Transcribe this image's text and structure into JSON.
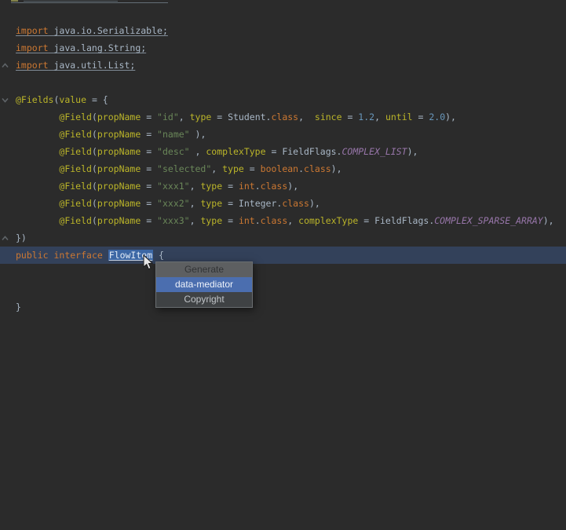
{
  "editor": {
    "language": "java",
    "lines": [
      {
        "segs": []
      },
      {
        "u": true,
        "segs": [
          [
            "kw",
            "import"
          ],
          [
            "plain",
            " java.io.Serializable;"
          ]
        ]
      },
      {
        "u": true,
        "segs": [
          [
            "kw",
            "import"
          ],
          [
            "plain",
            " java.lang.String;"
          ]
        ]
      },
      {
        "u": true,
        "segs": [
          [
            "kw",
            "import"
          ],
          [
            "plain",
            " java.util.List;"
          ]
        ]
      },
      {
        "segs": []
      },
      {
        "segs": [
          [
            "ann",
            "@Fields"
          ],
          [
            "plain",
            "("
          ],
          [
            "ann",
            "value"
          ],
          [
            "plain",
            " = {"
          ]
        ]
      },
      {
        "segs": [
          [
            "plain",
            "        "
          ],
          [
            "ann",
            "@Field"
          ],
          [
            "plain",
            "("
          ],
          [
            "ann",
            "propName"
          ],
          [
            "plain",
            " = "
          ],
          [
            "str",
            "\"id\""
          ],
          [
            "plain",
            ", "
          ],
          [
            "ann",
            "type"
          ],
          [
            "plain",
            " = Student."
          ],
          [
            "kw",
            "class"
          ],
          [
            "plain",
            ",  "
          ],
          [
            "ann",
            "since"
          ],
          [
            "plain",
            " = "
          ],
          [
            "num",
            "1.2"
          ],
          [
            "plain",
            ", "
          ],
          [
            "ann",
            "until"
          ],
          [
            "plain",
            " = "
          ],
          [
            "num",
            "2.0"
          ],
          [
            "plain",
            "),"
          ]
        ]
      },
      {
        "segs": [
          [
            "plain",
            "        "
          ],
          [
            "ann",
            "@Field"
          ],
          [
            "plain",
            "("
          ],
          [
            "ann",
            "propName"
          ],
          [
            "plain",
            " = "
          ],
          [
            "str",
            "\"name\""
          ],
          [
            "plain",
            " ),"
          ]
        ]
      },
      {
        "segs": [
          [
            "plain",
            "        "
          ],
          [
            "ann",
            "@Field"
          ],
          [
            "plain",
            "("
          ],
          [
            "ann",
            "propName"
          ],
          [
            "plain",
            " = "
          ],
          [
            "str",
            "\"desc\""
          ],
          [
            "plain",
            " , "
          ],
          [
            "ann",
            "complexType"
          ],
          [
            "plain",
            " = FieldFlags."
          ],
          [
            "const",
            "COMPLEX_LIST"
          ],
          [
            "plain",
            "),"
          ]
        ]
      },
      {
        "segs": [
          [
            "plain",
            "        "
          ],
          [
            "ann",
            "@Field"
          ],
          [
            "plain",
            "("
          ],
          [
            "ann",
            "propName"
          ],
          [
            "plain",
            " = "
          ],
          [
            "str",
            "\"selected\""
          ],
          [
            "plain",
            ", "
          ],
          [
            "ann",
            "type"
          ],
          [
            "plain",
            " = "
          ],
          [
            "kw",
            "boolean"
          ],
          [
            "plain",
            "."
          ],
          [
            "kw",
            "class"
          ],
          [
            "plain",
            "),"
          ]
        ]
      },
      {
        "segs": [
          [
            "plain",
            "        "
          ],
          [
            "ann",
            "@Field"
          ],
          [
            "plain",
            "("
          ],
          [
            "ann",
            "propName"
          ],
          [
            "plain",
            " = "
          ],
          [
            "str",
            "\"xxx1\""
          ],
          [
            "plain",
            ", "
          ],
          [
            "ann",
            "type"
          ],
          [
            "plain",
            " = "
          ],
          [
            "kw",
            "int"
          ],
          [
            "plain",
            "."
          ],
          [
            "kw",
            "class"
          ],
          [
            "plain",
            "),"
          ]
        ]
      },
      {
        "segs": [
          [
            "plain",
            "        "
          ],
          [
            "ann",
            "@Field"
          ],
          [
            "plain",
            "("
          ],
          [
            "ann",
            "propName"
          ],
          [
            "plain",
            " = "
          ],
          [
            "str",
            "\"xxx2\""
          ],
          [
            "plain",
            ", "
          ],
          [
            "ann",
            "type"
          ],
          [
            "plain",
            " = Integer."
          ],
          [
            "kw",
            "class"
          ],
          [
            "plain",
            "),"
          ]
        ]
      },
      {
        "segs": [
          [
            "plain",
            "        "
          ],
          [
            "ann",
            "@Field"
          ],
          [
            "plain",
            "("
          ],
          [
            "ann",
            "propName"
          ],
          [
            "plain",
            " = "
          ],
          [
            "str",
            "\"xxx3\""
          ],
          [
            "plain",
            ", "
          ],
          [
            "ann",
            "type"
          ],
          [
            "plain",
            " = "
          ],
          [
            "kw",
            "int"
          ],
          [
            "plain",
            "."
          ],
          [
            "kw",
            "class"
          ],
          [
            "plain",
            ", "
          ],
          [
            "ann",
            "complexType"
          ],
          [
            "plain",
            " = FieldFlags."
          ],
          [
            "const",
            "COMPLEX_SPARSE_ARRAY"
          ],
          [
            "plain",
            "),"
          ]
        ]
      },
      {
        "segs": [
          [
            "plain",
            "})"
          ]
        ]
      },
      {
        "hl": true,
        "segs": [
          [
            "kw",
            "public"
          ],
          [
            "plain",
            " "
          ],
          [
            "kw",
            "interface"
          ],
          [
            "plain",
            " "
          ],
          [
            "selword",
            "FlowItem"
          ],
          [
            "plain",
            " {"
          ]
        ]
      },
      {
        "segs": []
      },
      {
        "segs": []
      },
      {
        "segs": [
          [
            "plain",
            "}"
          ]
        ]
      }
    ],
    "selected_identifier": "FlowItem",
    "fold_markers": [
      {
        "at_line": "import java.util.List;",
        "dir": "up"
      },
      {
        "at_line": "@Fields(value = {",
        "dir": "down"
      },
      {
        "at_line": "})",
        "dir": "up"
      }
    ]
  },
  "popup": {
    "title": "Generate",
    "items": [
      {
        "label": "data-mediator",
        "selected": true
      },
      {
        "label": "Copyright",
        "selected": false
      }
    ]
  },
  "colors": {
    "editor_bg": "#2b2b2b",
    "text": "#a9b7c6",
    "keyword": "#cc7832",
    "annotation": "#bbb529",
    "string": "#6a8759",
    "number": "#6897bb",
    "constant": "#9876aa",
    "underline_color": "#7f8b96",
    "line_highlight": "#33415a",
    "word_selection": "#3c67a5",
    "popup_bg": "#3f4244",
    "popup_border": "#6a6e71",
    "popup_title_bg": "#5d5f61",
    "popup_title_text": "#313335",
    "popup_text": "#c0c4c8",
    "popup_selected": "#4b6eaf",
    "fold_icon": "#5f6468"
  }
}
